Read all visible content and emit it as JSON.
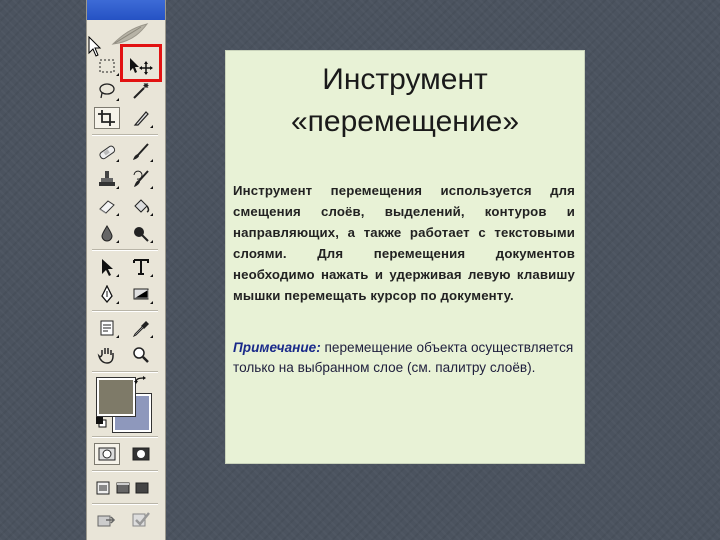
{
  "panel": {
    "title_line1": "Инструмент",
    "title_line2": "«перемещение»",
    "description": "Инструмент перемещения используется для смещения слоёв, выделений, контуров и направляющих, а также работает с текстовыми слоями. Для перемещения документов необходимо нажать и удерживая левую клавишу мышки перемещать курсор по документу.",
    "note_label": "Примечание:",
    "note_text": " перемещение объекта осуществляется только на выбранном слое (см. палитру слоёв)."
  },
  "toolbox": {
    "selected_tool": "move-tool",
    "colors": {
      "foreground": "#7e7a68",
      "background": "#8e98bc",
      "highlight": "#e21212",
      "panel": "#e8f2d6"
    },
    "tools": [
      "marquee-tool",
      "move-tool",
      "lasso-tool",
      "magic-wand-tool",
      "crop-tool",
      "slice-tool",
      "healing-brush-tool",
      "brush-tool",
      "clone-stamp-tool",
      "history-brush-tool",
      "eraser-tool",
      "paint-bucket-tool",
      "blur-tool",
      "dodge-tool",
      "path-selection-tool",
      "type-tool",
      "pen-tool",
      "rectangle-tool",
      "notes-tool",
      "eyedropper-tool",
      "hand-tool",
      "zoom-tool"
    ]
  }
}
